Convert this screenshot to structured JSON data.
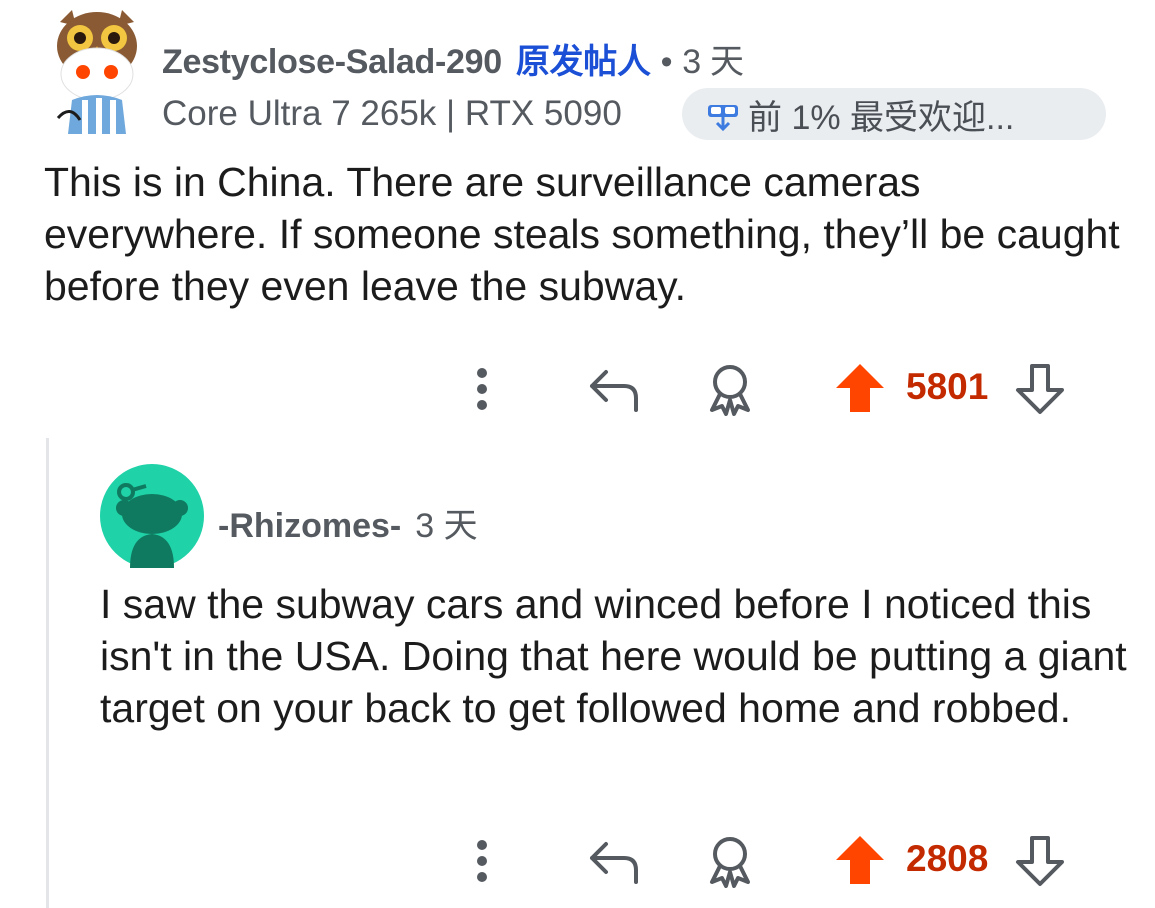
{
  "comments": [
    {
      "username": "Zestyclose-Salad-290",
      "op_label": "原发帖人",
      "separator": "•",
      "time": "3 天",
      "flair": "Core Ultra 7 265k | RTX 5090",
      "badge": "前 1% 最受欢迎...",
      "body": "This is in China. There are surveillance cameras everywhere. If someone steals something, they’ll be caught before they even leave the subway.",
      "votes": "5801"
    },
    {
      "username": "-Rhizomes-",
      "time": "3 天",
      "body": "I saw the subway cars and winced before I noticed this isn't in the USA. Doing that here would be putting a giant target on your back to get followed home and robbed.",
      "votes": "2808"
    }
  ],
  "colors": {
    "upvote": "#ff4500",
    "vote_count": "#c32a00",
    "op_label": "#1a4fd6",
    "avatar2_bg": "#1fd2a8"
  },
  "icons": [
    "more-options-icon",
    "reply-icon",
    "award-icon",
    "upvote-icon",
    "downvote-icon",
    "top-contributor-icon"
  ]
}
